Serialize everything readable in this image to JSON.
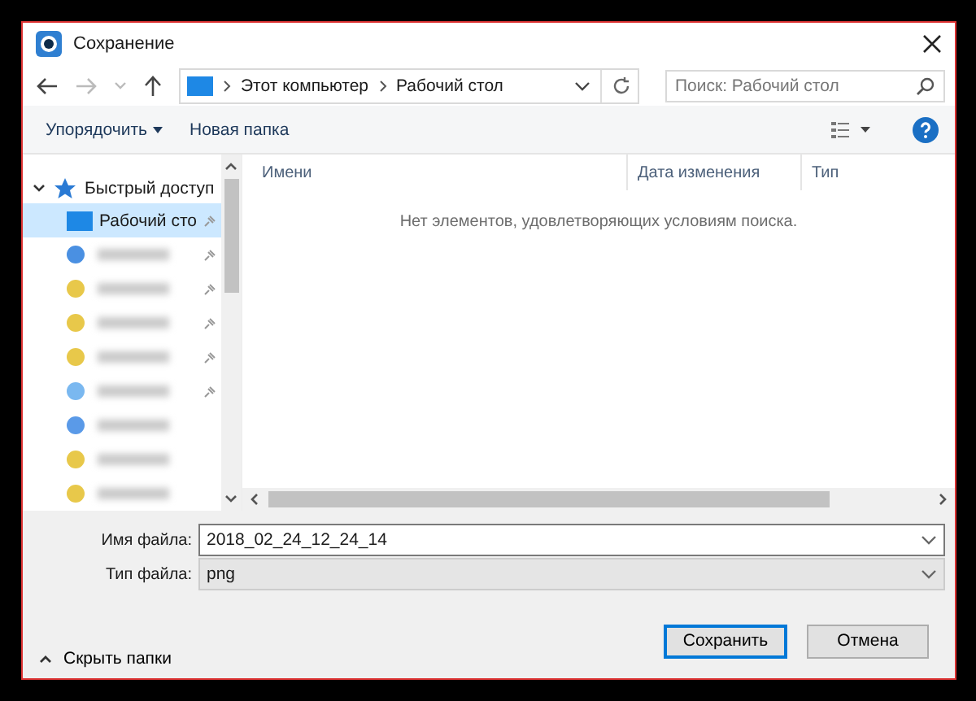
{
  "window": {
    "title": "Сохранение"
  },
  "nav": {
    "back_disabled": false,
    "forward_disabled": true,
    "path": [
      "Этот компьютер",
      "Рабочий стол"
    ],
    "search": {
      "placeholder": "Поиск: Рабочий стол"
    }
  },
  "toolbar": {
    "organize": "Упорядочить",
    "new_folder": "Новая папка"
  },
  "sidebar": {
    "quick_access": {
      "label": "Быстрый доступ",
      "expanded": true
    },
    "items": [
      {
        "label": "Рабочий сто",
        "selected": true,
        "pinned": true,
        "color": "#1e88e5",
        "blurred": false
      },
      {
        "selected": false,
        "pinned": true,
        "color": "#4a90e2",
        "blurred": true
      },
      {
        "selected": false,
        "pinned": true,
        "color": "#e8c84a",
        "blurred": true
      },
      {
        "selected": false,
        "pinned": true,
        "color": "#e8c84a",
        "blurred": true
      },
      {
        "selected": false,
        "pinned": true,
        "color": "#e8c84a",
        "blurred": true
      },
      {
        "selected": false,
        "pinned": true,
        "color": "#7ab8f0",
        "blurred": true
      },
      {
        "selected": false,
        "pinned": false,
        "color": "#5a9ae8",
        "blurred": true
      },
      {
        "selected": false,
        "pinned": false,
        "color": "#e8c84a",
        "blurred": true
      },
      {
        "selected": false,
        "pinned": false,
        "color": "#e8c84a",
        "blurred": true
      }
    ]
  },
  "list": {
    "columns": [
      "Имени",
      "Дата изменения",
      "Тип"
    ],
    "empty_message": "Нет элементов, удовлетворяющих условиям поиска."
  },
  "fields": [
    {
      "label": "Имя файла:",
      "value": "2018_02_24_12_24_14",
      "kind": "editable"
    },
    {
      "label": "Тип файла:",
      "value": "png",
      "kind": "select"
    }
  ],
  "footer": {
    "hide_folders": "Скрыть папки",
    "buttons": [
      {
        "label": "Сохранить",
        "default": true
      },
      {
        "label": "Отмена",
        "default": false
      }
    ]
  }
}
